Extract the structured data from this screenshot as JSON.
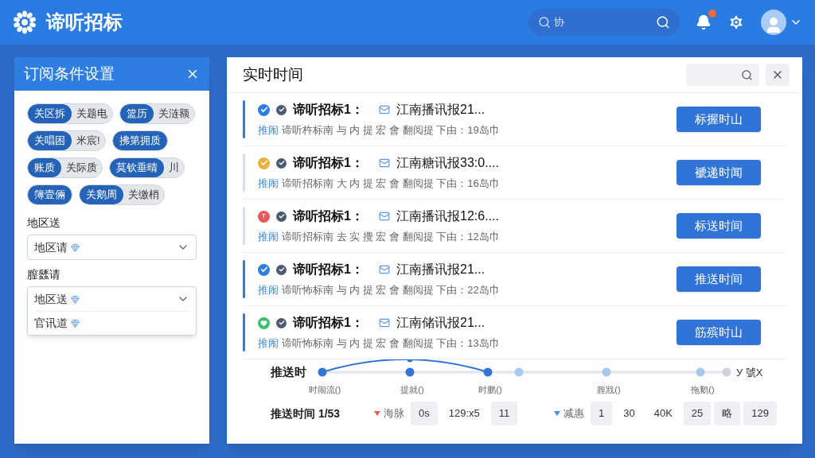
{
  "header": {
    "title": "谛听招标",
    "search": {
      "value": "协"
    },
    "notifications": {
      "unread": true
    }
  },
  "subscription_panel": {
    "title": "订阅条件设置",
    "tags": [
      {
        "primary": "关区拆",
        "secondary": "关题电"
      },
      {
        "primary": "篮历",
        "secondary": "关涟额"
      },
      {
        "primary": "关唱困",
        "secondary": "米宸!"
      },
      {
        "primary": "拂第拥质"
      },
      {
        "primary": "账质",
        "secondary": "关际质"
      },
      {
        "primary": "莫钦垂晴",
        "secondary": "川"
      },
      {
        "primary": "簿壹倆"
      },
      {
        "primary": "关鹅周",
        "secondary": "关缴梢"
      }
    ],
    "fields": [
      {
        "label": "地区送",
        "options": [
          "地区请"
        ],
        "expanded": false
      },
      {
        "label": "膣瓥请",
        "options": [
          "地区送",
          "官讯道"
        ],
        "expanded": true
      }
    ]
  },
  "feed_panel": {
    "title": "实时时间",
    "items": [
      {
        "selected": true,
        "color": "#2f7de1",
        "kind": "check",
        "title": "谛听招标1：",
        "source": "江南播讯报21...",
        "tag": "推闹",
        "summary": "谛听杵标南 与 内 提 宏 會  翻阅提 下由：19岛巾",
        "action": "标握时山"
      },
      {
        "selected": false,
        "color": "#e8b23a",
        "kind": "check",
        "title": "谛听招标1：",
        "source": "江南糖讯报33:0....",
        "tag": "推闹",
        "summary": "谛听招标南 大 内 提 宏 會  翻阅提 下由：16岛巾",
        "action": "褫递时闻"
      },
      {
        "selected": false,
        "color": "#e55a5a",
        "kind": "letter",
        "letter": "T",
        "title": "谛听招标1：",
        "source": "江南播讯报12:6....",
        "tag": "推闹",
        "summary": "谛听招标南 去 实 攪 宏 會  翻阅提 下由：12岛巾",
        "action": "标送时间"
      },
      {
        "selected": true,
        "color": "#2f7de1",
        "kind": "check",
        "title": "谛听招标1：",
        "source": "江南播讯报21...",
        "tag": "推闹",
        "summary": "谛听怖标南 与 内 提 宏 會  翻阅提 下由：22岛巾",
        "action": "推送时间"
      },
      {
        "selected": true,
        "color": "#3cc06a",
        "kind": "heart",
        "title": "谛听招标1：",
        "source": "江南储讯报21...",
        "tag": "推闹",
        "summary": "谛听怖标南 与 内 提 宏 會  翻阅提 下由：13岛巾",
        "action": "筋殡时山"
      }
    ],
    "timeline": {
      "label": "推送时",
      "end_label": "У 號X",
      "nodes": [
        {
          "kind": "done",
          "label": "时闹流()"
        },
        {
          "kind": "done",
          "label": "提就()"
        },
        {
          "kind": "done",
          "label": "时鹏()"
        },
        {
          "kind": "pending"
        },
        {
          "kind": "pending",
          "label": "膣戕()"
        },
        {
          "kind": "pending",
          "label": "拖鹅()"
        },
        {
          "kind": "end"
        }
      ]
    },
    "stats": {
      "label": "推送时间 1/53",
      "groups": [
        {
          "kind": "down",
          "color": "#e55a5a",
          "label": "海脉",
          "cells": [
            {
              "text": "0s",
              "boxed": true
            },
            {
              "text": "129:x5",
              "boxed": false
            },
            {
              "text": "11",
              "boxed": true
            }
          ]
        },
        {
          "kind": "down",
          "color": "#4a8fe0",
          "label": "减惠",
          "cells": [
            {
              "text": "1",
              "boxed": true
            },
            {
              "text": "30",
              "boxed": false
            },
            {
              "text": "40K",
              "boxed": false
            },
            {
              "text": "25",
              "boxed": true
            },
            {
              "text": "略",
              "boxed": true
            },
            {
              "text": "129",
              "boxed": true
            }
          ]
        }
      ]
    }
  }
}
